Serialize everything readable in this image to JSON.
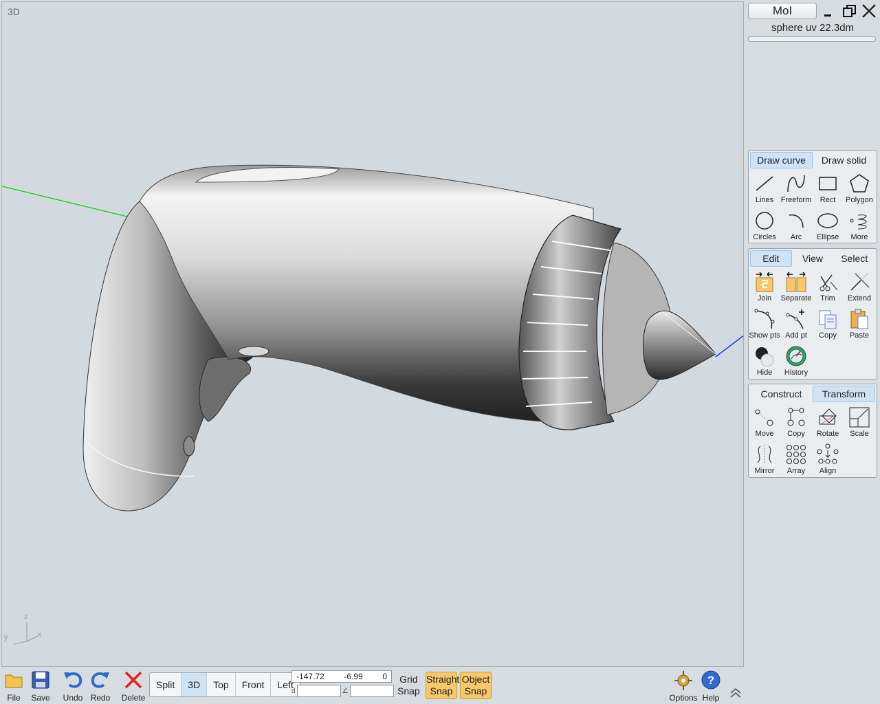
{
  "viewport": {
    "label": "3D",
    "axis_z": "z",
    "axis_y": "y",
    "axis_x": "x"
  },
  "panel": {
    "app_button": "MoI",
    "scene_info": "sphere uv 22.3dm",
    "draw_palette": {
      "tabs": [
        "Draw curve",
        "Draw solid"
      ],
      "active_tab": 0,
      "tools": [
        {
          "label": "Lines",
          "icon": "line-icon"
        },
        {
          "label": "Freeform",
          "icon": "freeform-curve-icon"
        },
        {
          "label": "Rect",
          "icon": "rectangle-icon"
        },
        {
          "label": "Polygon",
          "icon": "polygon-icon"
        },
        {
          "label": "Circles",
          "icon": "circle-icon"
        },
        {
          "label": "Arc",
          "icon": "arc-icon"
        },
        {
          "label": "Ellipse",
          "icon": "ellipse-icon"
        },
        {
          "label": "More",
          "icon": "more-curves-icon"
        }
      ]
    },
    "edit_palette": {
      "tabs": [
        "Edit",
        "View",
        "Select"
      ],
      "active_tab": 0,
      "tools": [
        {
          "label": "Join",
          "icon": "join-icon"
        },
        {
          "label": "Separate",
          "icon": "separate-icon"
        },
        {
          "label": "Trim",
          "icon": "trim-icon"
        },
        {
          "label": "Extend",
          "icon": "extend-icon"
        },
        {
          "label": "Show pts",
          "icon": "show-points-icon"
        },
        {
          "label": "Add pt",
          "icon": "add-point-icon"
        },
        {
          "label": "Copy",
          "icon": "copy-icon"
        },
        {
          "label": "Paste",
          "icon": "paste-icon"
        },
        {
          "label": "Hide",
          "icon": "hide-icon"
        },
        {
          "label": "History",
          "icon": "history-icon"
        }
      ]
    },
    "transform_palette": {
      "tabs": [
        "Construct",
        "Transform"
      ],
      "active_tab": 1,
      "tools": [
        {
          "label": "Move",
          "icon": "move-icon"
        },
        {
          "label": "Copy",
          "icon": "copy-transform-icon"
        },
        {
          "label": "Rotate",
          "icon": "rotate-icon"
        },
        {
          "label": "Scale",
          "icon": "scale-icon"
        },
        {
          "label": "Mirror",
          "icon": "mirror-icon"
        },
        {
          "label": "Array",
          "icon": "array-icon"
        },
        {
          "label": "Align",
          "icon": "align-icon"
        }
      ]
    }
  },
  "bottombar": {
    "file": "File",
    "save": "Save",
    "undo": "Undo",
    "redo": "Redo",
    "delete": "Delete",
    "views": [
      "Split",
      "3D",
      "Top",
      "Front",
      "Left"
    ],
    "active_view": 1,
    "coords": {
      "x": "-147.72",
      "y": "-6.99",
      "z": "0",
      "distance_label": "d",
      "angle_label": "∠"
    },
    "grid_snap": [
      "Grid",
      "Snap"
    ],
    "straight_snap": [
      "Straight",
      "Snap"
    ],
    "object_snap": [
      "Object",
      "Snap"
    ],
    "options": "Options",
    "help": "Help"
  },
  "colors": {
    "accent_tab": "#cfe3f4",
    "snap_active": "#f6c86a",
    "axis_green": "#2ecc2e",
    "axis_blue": "#1a2bff"
  }
}
